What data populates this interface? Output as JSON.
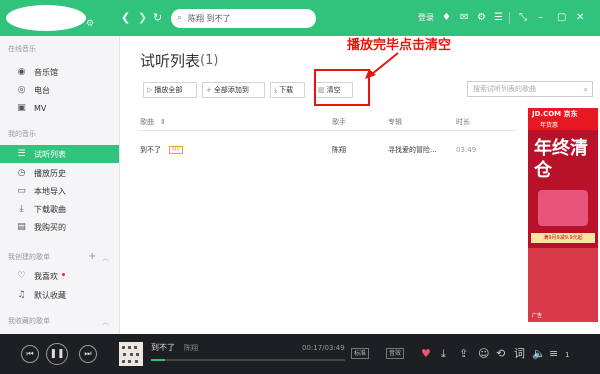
{
  "topbar": {
    "search_text": "陈翔 到不了",
    "login_text": "登录",
    "colors": {
      "brand": "#31c27c"
    },
    "icons": [
      "back-icon",
      "forward-icon",
      "refresh-icon",
      "search-icon",
      "skin-icon",
      "message-icon",
      "settings-icon",
      "mini-mode-icon",
      "minimize-icon",
      "maximize-icon",
      "close-icon"
    ]
  },
  "sidebar": {
    "online_title": "在线音乐",
    "online_items": [
      {
        "label": "音乐馆",
        "icon": "music-hall-icon"
      },
      {
        "label": "电台",
        "icon": "radio-icon"
      },
      {
        "label": "MV",
        "icon": "mv-icon"
      }
    ],
    "my_title": "我的音乐",
    "my_items": [
      {
        "label": "试听列表",
        "icon": "playlist-icon"
      },
      {
        "label": "播放历史",
        "icon": "history-icon"
      },
      {
        "label": "本地导入",
        "icon": "local-import-icon"
      },
      {
        "label": "下载歌曲",
        "icon": "download-icon"
      },
      {
        "label": "我购买的",
        "icon": "purchased-icon"
      }
    ],
    "created_title": "我创建的歌单",
    "created_items": [
      {
        "label": "我喜欢",
        "icon": "heart-icon"
      },
      {
        "label": "默认收藏",
        "icon": "music-note-icon"
      }
    ],
    "fav_title": "我收藏的歌单"
  },
  "main": {
    "title": "试听列表",
    "count": "(1)",
    "toolbar": {
      "play_all": "播放全部",
      "add_all": "全部添加到",
      "download": "下载",
      "clear": "清空"
    },
    "filter_placeholder": "搜索试听列表的歌曲",
    "columns": {
      "song": "歌曲",
      "artist": "歌手",
      "album": "专辑",
      "duration": "时长"
    },
    "rows": [
      {
        "song": "到不了",
        "badge": "MV",
        "artist": "陈翔",
        "album": "寻找爱的冒险...",
        "duration": "03:49"
      }
    ]
  },
  "annotation": {
    "text": "播放完毕点击清空",
    "color": "#e6150f"
  },
  "ad": {
    "brand": "JD.COM 京东",
    "sub": "年货惠",
    "headline": "年终清仓",
    "price": "满9月9减9.9元起",
    "label": "广告"
  },
  "player": {
    "song": "到不了",
    "artist": "陈翔",
    "time": "00:17/03:49",
    "progress": 0.07,
    "quality": "标准",
    "effect": "音效",
    "playlist_count": "1"
  }
}
